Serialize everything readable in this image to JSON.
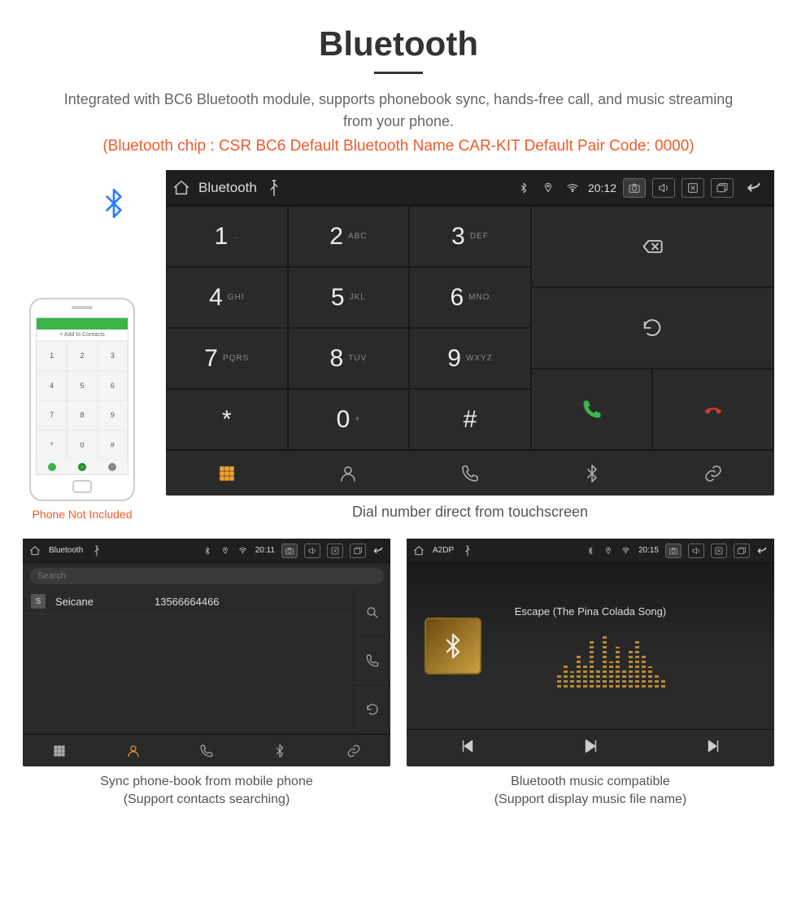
{
  "hero": {
    "title": "Bluetooth",
    "desc": "Integrated with BC6 Bluetooth module, supports phonebook sync, hands-free call, and music streaming from your phone.",
    "spec": "(Bluetooth chip : CSR BC6    Default Bluetooth Name CAR-KIT    Default Pair Code: 0000)"
  },
  "phone": {
    "add_label": "+  Add to Contacts",
    "keys": [
      "1",
      "2",
      "3",
      "4",
      "5",
      "6",
      "7",
      "8",
      "9",
      "*",
      "0",
      "#"
    ],
    "note": "Phone Not Included"
  },
  "statusbar_main": {
    "title": "Bluetooth",
    "time": "20:12"
  },
  "keypad": [
    {
      "n": "1",
      "l": ".."
    },
    {
      "n": "2",
      "l": "ABC"
    },
    {
      "n": "3",
      "l": "DEF"
    },
    {
      "n": "4",
      "l": "GHI"
    },
    {
      "n": "5",
      "l": "JKL"
    },
    {
      "n": "6",
      "l": "MNO"
    },
    {
      "n": "7",
      "l": "PQRS"
    },
    {
      "n": "8",
      "l": "TUV"
    },
    {
      "n": "9",
      "l": "WXYZ"
    },
    {
      "n": "*",
      "l": ""
    },
    {
      "n": "0",
      "l": "+"
    },
    {
      "n": "#",
      "l": ""
    }
  ],
  "caption_main": "Dial number direct from touchscreen",
  "contacts_screen": {
    "statusbar": {
      "title": "Bluetooth",
      "time": "20:11"
    },
    "search_placeholder": "Search",
    "item": {
      "initial": "S",
      "name": "Seicane",
      "number": "13566664466"
    },
    "caption_l1": "Sync phone-book from mobile phone",
    "caption_l2": "(Support contacts searching)"
  },
  "music_screen": {
    "statusbar": {
      "title": "A2DP",
      "time": "20:15"
    },
    "track": "Escape (The Pina Colada Song)",
    "caption_l1": "Bluetooth music compatible",
    "caption_l2": "(Support display music file name)"
  },
  "eq_heights": [
    16,
    28,
    20,
    42,
    30,
    58,
    24,
    66,
    32,
    50,
    22,
    46,
    58,
    40,
    26,
    18,
    10
  ]
}
